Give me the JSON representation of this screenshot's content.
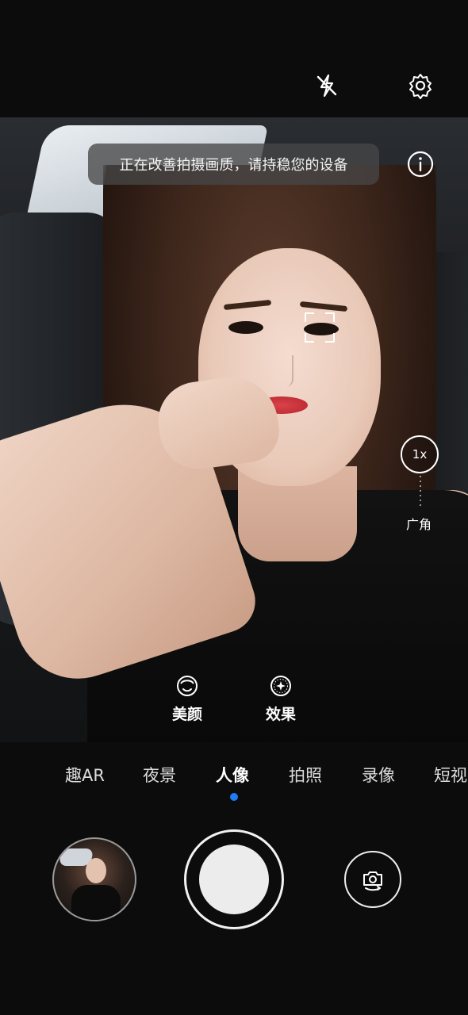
{
  "toast": {
    "text": "正在改善拍摄画质，请持稳您的设备"
  },
  "top_bar": {
    "flash_icon": "flash-off-icon",
    "settings_icon": "gear-icon",
    "info_icon": "info-icon"
  },
  "zoom": {
    "level": "1x",
    "wide_label": "广角"
  },
  "quick_actions": {
    "beauty": {
      "label": "美颜",
      "icon": "face-beauty-icon"
    },
    "effect": {
      "label": "效果",
      "icon": "sparkle-effect-icon"
    }
  },
  "modes": [
    {
      "label": "趣AR"
    },
    {
      "label": "夜景"
    },
    {
      "label": "人像",
      "active": true
    },
    {
      "label": "拍照"
    },
    {
      "label": "录像"
    },
    {
      "label": "短视"
    }
  ],
  "colors": {
    "accent_dot": "#1f7cf2",
    "toast_bg": "#464646"
  },
  "bottom": {
    "gallery_icon": "gallery-thumbnail",
    "shutter_icon": "shutter-button",
    "switch_icon": "camera-switch-icon"
  }
}
